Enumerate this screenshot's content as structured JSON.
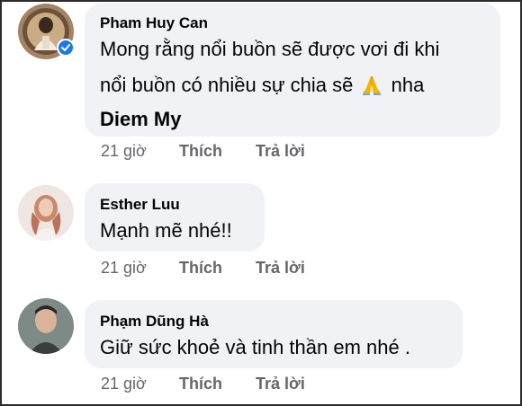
{
  "comments": [
    {
      "author": "Pham Huy Can",
      "lines": [
        "Mong rằng nổi buồn sẽ được vơi đi khi",
        "nổi buồn có nhiều sự chia sẽ",
        "nha"
      ],
      "tagged_name": "Diem My",
      "emoji": "folded-hands-icon",
      "time": "21 giờ",
      "like_label": "Thích",
      "reply_label": "Trả lời"
    },
    {
      "author": "Esther Luu",
      "text": "Mạnh mẽ nhé!!",
      "time": "21 giờ",
      "like_label": "Thích",
      "reply_label": "Trả lời"
    },
    {
      "author": "Phạm Dũng Hà",
      "text": "Giữ sức khoẻ và tinh thần em nhé .",
      "verified": true,
      "time": "21 giờ",
      "like_label": "Thích",
      "reply_label": "Trả lời"
    }
  ],
  "colors": {
    "bubble": "#f0f2f5",
    "meta_text": "#65676b",
    "name_text": "#050505",
    "verified_badge": "#1877f2"
  }
}
